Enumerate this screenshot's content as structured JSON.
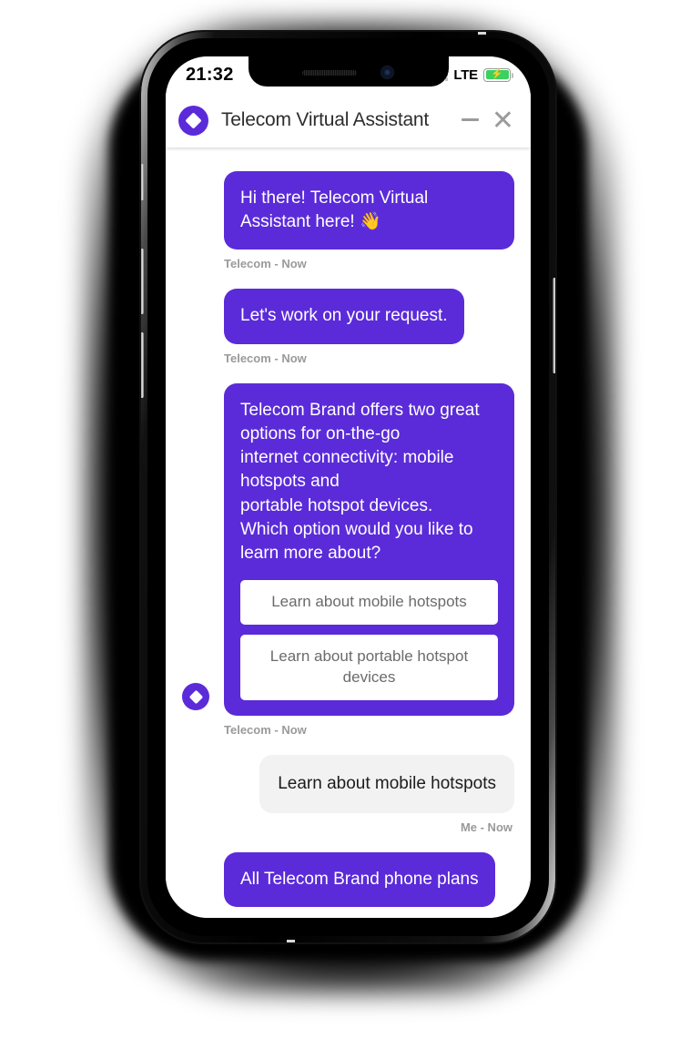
{
  "status_bar": {
    "time": "21:32",
    "network": "LTE",
    "signal_icon": "signal-bars-icon",
    "battery_icon": "battery-charging-icon",
    "battery_color": "#3bd15e"
  },
  "chat": {
    "header": {
      "title": "Telecom Virtual Assistant",
      "logo_icon": "brand-diamond-logo",
      "minimize_label": "–",
      "close_label": "✕",
      "accent_color": "#5b2bd9"
    },
    "messages": [
      {
        "sender": "bot",
        "text": "Hi there! Telecom Virtual Assistant here! 👋",
        "meta": "Telecom - Now"
      },
      {
        "sender": "bot",
        "text": "Let's work on your request.",
        "meta": "Telecom - Now"
      },
      {
        "sender": "bot",
        "text": "Telecom Brand offers two great options for on-the-go\ninternet connectivity: mobile hotspots and\nportable hotspot devices.\nWhich option would you like to learn more about?",
        "meta": "Telecom - Now",
        "avatar_icon": "bot-avatar-diamond",
        "quick_replies": [
          "Learn about mobile hotspots",
          "Learn about portable hotspot devices"
        ]
      },
      {
        "sender": "user",
        "text": "Learn about mobile hotspots",
        "meta": "Me - Now"
      },
      {
        "sender": "bot",
        "text": "All Telecom Brand phone plans",
        "meta": ""
      }
    ]
  }
}
